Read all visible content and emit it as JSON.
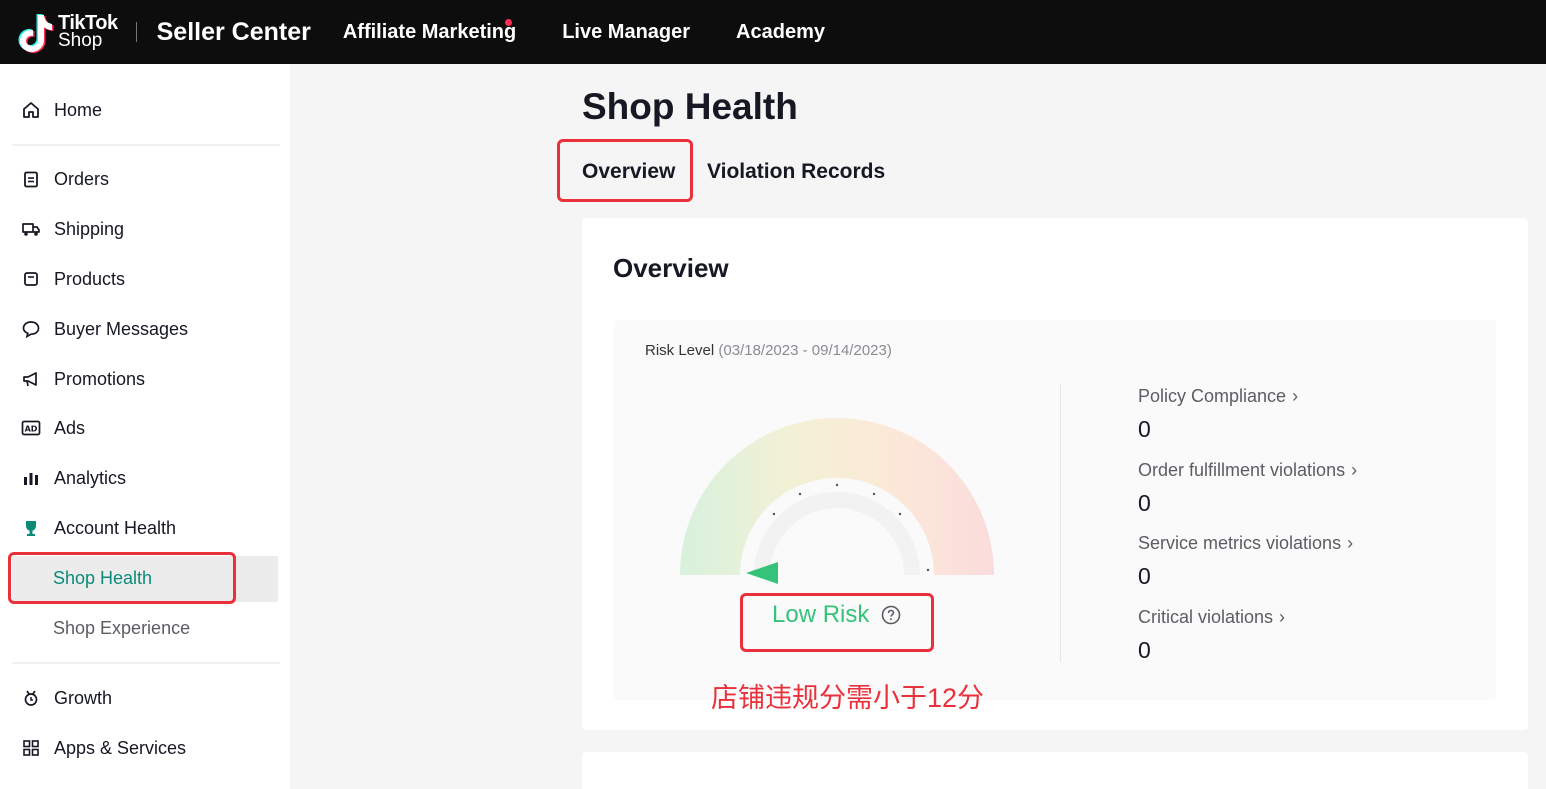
{
  "header": {
    "logo_line1": "TikTok",
    "logo_line2": "Shop",
    "brand": "Seller Center",
    "nav": [
      "Affiliate Marketing",
      "Live Manager",
      "Academy"
    ]
  },
  "sidebar": {
    "items": [
      {
        "label": "Home",
        "icon": "home-icon"
      },
      {
        "label": "Orders",
        "icon": "clipboard-icon"
      },
      {
        "label": "Shipping",
        "icon": "truck-icon"
      },
      {
        "label": "Products",
        "icon": "box-icon"
      },
      {
        "label": "Buyer Messages",
        "icon": "chat-icon"
      },
      {
        "label": "Promotions",
        "icon": "megaphone-icon"
      },
      {
        "label": "Ads",
        "icon": "ad-icon"
      },
      {
        "label": "Analytics",
        "icon": "bar-chart-icon"
      },
      {
        "label": "Account Health",
        "icon": "trophy-icon"
      }
    ],
    "sub_items": [
      "Shop Health",
      "Shop Experience"
    ],
    "bottom_items": [
      {
        "label": "Growth",
        "icon": "growth-icon"
      },
      {
        "label": "Apps & Services",
        "icon": "grid-icon"
      }
    ]
  },
  "main": {
    "title": "Shop Health",
    "tabs": [
      "Overview",
      "Violation Records"
    ],
    "card_title": "Overview",
    "risk_label": "Risk Level",
    "risk_range": "(03/18/2023 - 09/14/2023)",
    "risk_status": "Low Risk",
    "stats": [
      {
        "label": "Policy Compliance",
        "value": "0"
      },
      {
        "label": "Order fulfillment violations",
        "value": "0"
      },
      {
        "label": "Service metrics violations",
        "value": "0"
      },
      {
        "label": "Critical violations",
        "value": "0"
      }
    ],
    "annotation": "店铺违规分需小于12分"
  },
  "colors": {
    "accent_green": "#35c37a",
    "annotation_red": "#e8313b",
    "header_bg": "#0d0d0d"
  }
}
